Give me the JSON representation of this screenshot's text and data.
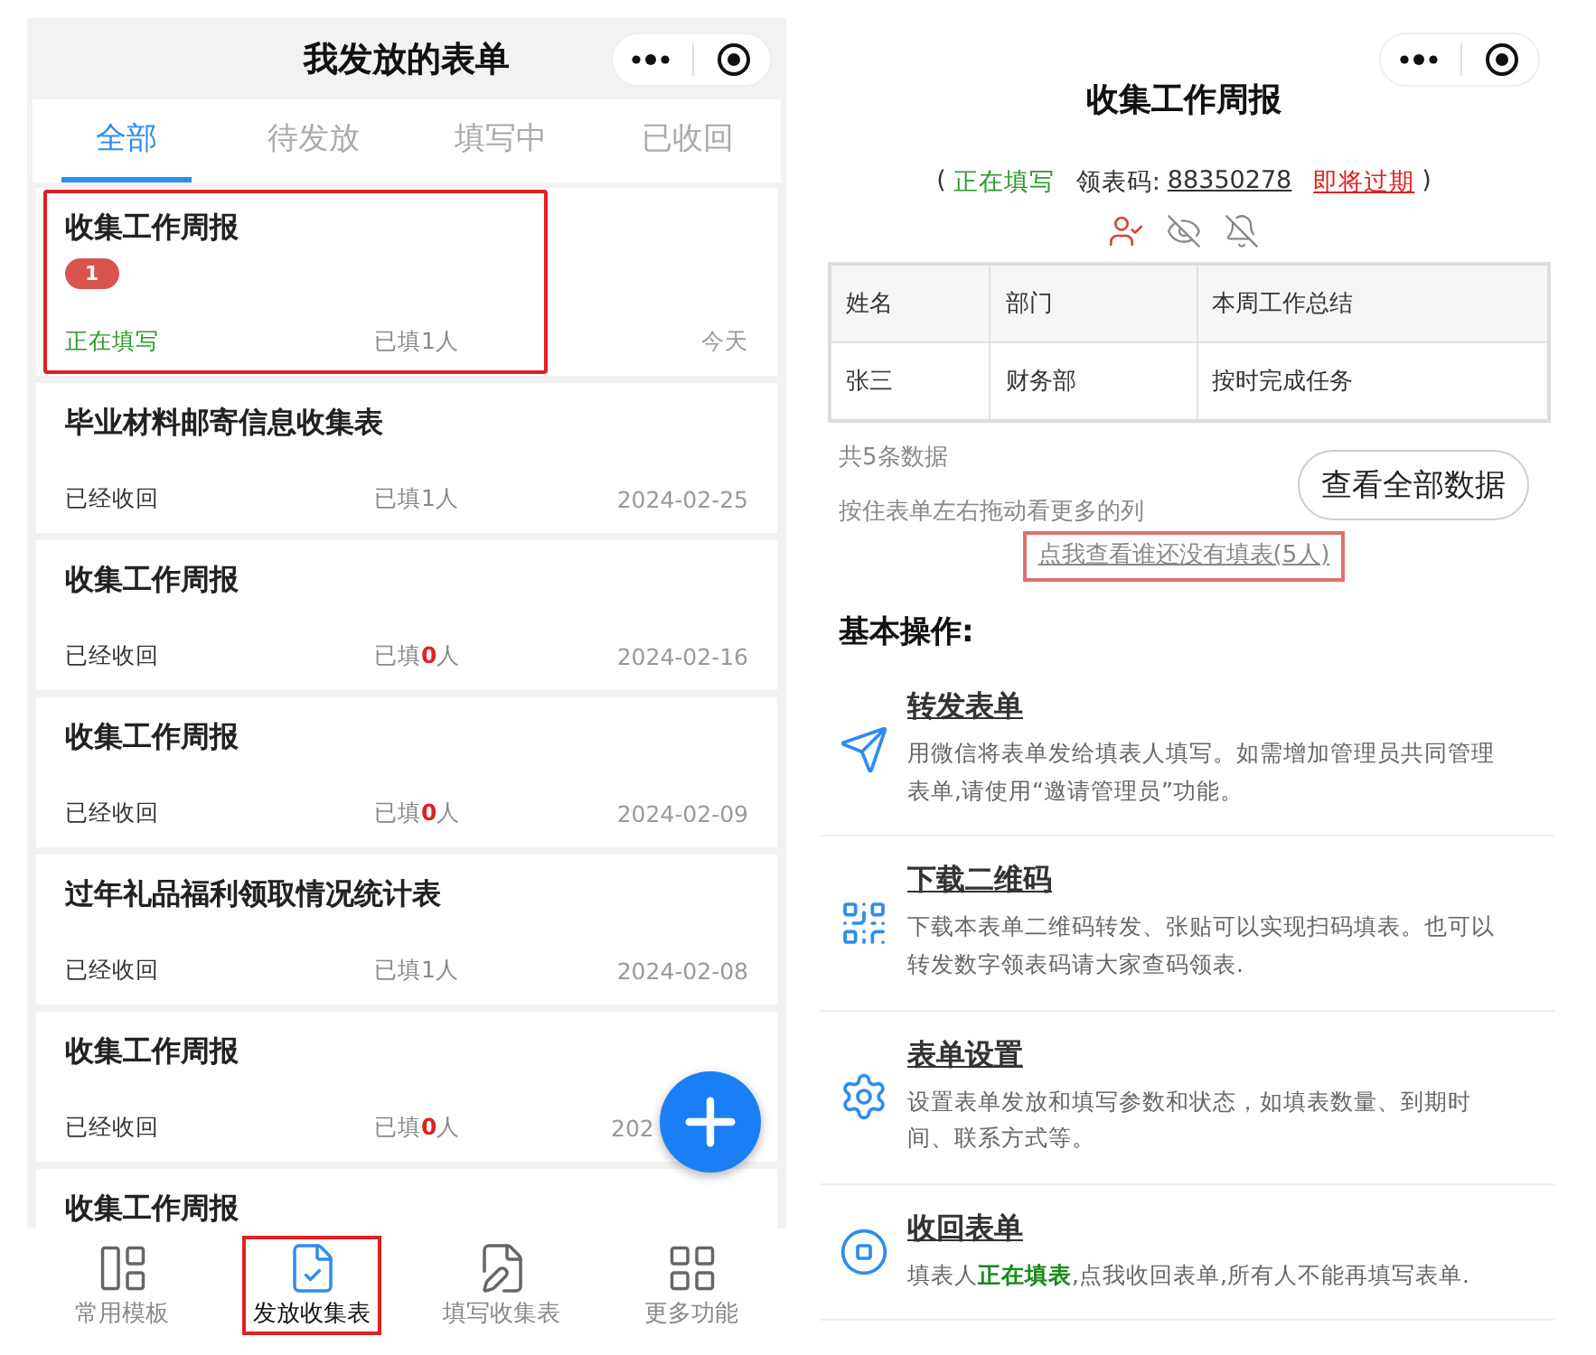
{
  "left": {
    "title": "我发放的表单",
    "tabs": [
      {
        "label": "全部",
        "selected": true
      },
      {
        "label": "待发放",
        "selected": false
      },
      {
        "label": "填写中",
        "selected": false
      },
      {
        "label": "已收回",
        "selected": false
      }
    ],
    "cards": [
      {
        "title": "收集工作周报",
        "badge": "1",
        "status": "正在填写",
        "kind": "filling",
        "filled": "已填1人",
        "date": "今天",
        "highlighted": true
      },
      {
        "title": "毕业材料邮寄信息收集表",
        "status": "已经收回",
        "kind": "collected",
        "filled": "已填1人",
        "date": "2024-02-25",
        "highlighted": false
      },
      {
        "title": "收集工作周报",
        "status": "已经收回",
        "kind": "collected",
        "filled": "已填**0**人",
        "date": "2024-02-16",
        "highlighted": false
      },
      {
        "title": "收集工作周报",
        "status": "已经收回",
        "kind": "collected",
        "filled": "已填**0**人",
        "date": "2024-02-09",
        "highlighted": false
      },
      {
        "title": "过年礼品福利领取情况统计表",
        "status": "已经收回",
        "kind": "collected",
        "filled": "已填1人",
        "date": "2024-02-08",
        "highlighted": false
      },
      {
        "title": "收集工作周报",
        "status": "已经收回",
        "kind": "collected",
        "filled": "已填**0**人",
        "date": "202",
        "highlighted": false
      },
      {
        "title": "收集工作周报",
        "highlighted": false
      }
    ],
    "nav": [
      {
        "label": "常用模板",
        "kind": "layout",
        "selected": false
      },
      {
        "label": "发放收集表",
        "kind": "form",
        "selected": true
      },
      {
        "label": "填写收集表",
        "kind": "edit",
        "selected": false
      },
      {
        "label": "更多功能",
        "kind": "grid",
        "selected": false
      }
    ]
  },
  "right": {
    "title": "收集工作周报",
    "status_parts": [
      {
        "kind": "plain",
        "text": "("
      },
      {
        "kind": "state",
        "text": "正在填写"
      },
      {
        "kind": "plain",
        "text": "领表码:"
      },
      {
        "kind": "code",
        "text": "88350278"
      },
      {
        "kind": "warning",
        "text": "即将过期"
      },
      {
        "kind": "plain",
        "text": ")"
      }
    ],
    "table": {
      "columns": [
        "姓名",
        "部门",
        "本周工作总结"
      ],
      "rows": [
        [
          "张三",
          "财务部",
          "按时完成任务"
        ]
      ]
    },
    "count": "共5条数据",
    "hint": "按住表单左右拖动看更多的列",
    "view_all_button": "查看全部数据",
    "missing_link": {
      "text": "点我查看谁还没有填表(5人)",
      "highlighted": true
    },
    "section_title": "基本操作:",
    "actions": [
      {
        "kind": "send",
        "title": "转发表单",
        "description": "用微信将表单发给填表人填写。如需增加管理员共同管理表单,请使用“邀请管理员”功能。"
      },
      {
        "kind": "qr",
        "title": "下载二维码",
        "description": "下载本表单二维码转发、张贴可以实现扫码填表。也可以转发数字领表码请大家查码领表."
      },
      {
        "kind": "gear",
        "title": "表单设置",
        "description": "设置表单发放和填写参数和状态，如填表数量、到期时间、联系方式等。"
      },
      {
        "kind": "stop",
        "title": "收回表单",
        "description": "填表人**正在填表**,点我收回表单,所有人不能再填写表单."
      }
    ]
  }
}
